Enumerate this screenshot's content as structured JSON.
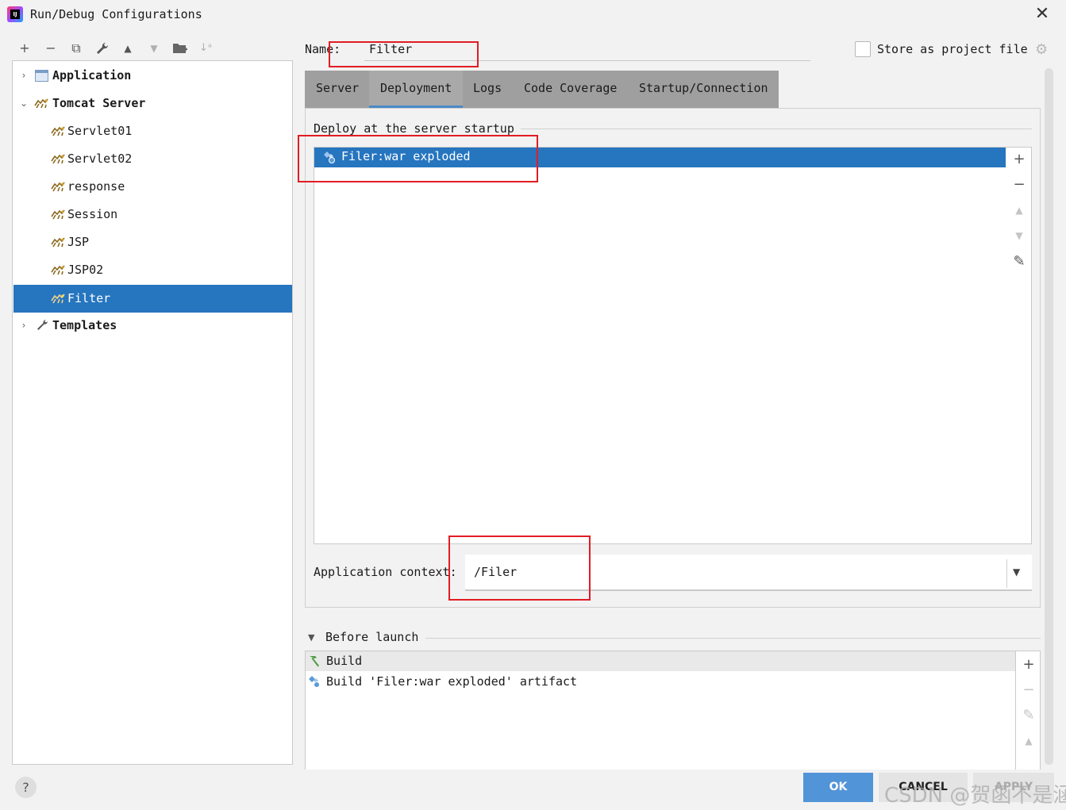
{
  "window": {
    "title": "Run/Debug Configurations",
    "close_glyph": "✕"
  },
  "toolbar": {
    "buttons": [
      {
        "name": "add-icon",
        "glyph": "+"
      },
      {
        "name": "remove-icon",
        "glyph": "−"
      },
      {
        "name": "copy-icon",
        "glyph": "⧉"
      },
      {
        "name": "wrench-icon",
        "glyph": "🔧"
      },
      {
        "name": "move-up-icon",
        "glyph": "▲"
      },
      {
        "name": "move-down-icon",
        "glyph": "▼"
      },
      {
        "name": "folder-add-icon",
        "glyph": "📁"
      },
      {
        "name": "sort-icon",
        "glyph": "↓ᵃ"
      }
    ]
  },
  "tree": {
    "application_label": "Application",
    "tomcat_label": "Tomcat Server",
    "children": [
      "Servlet01",
      "Servlet02",
      "response",
      "Session",
      "JSP",
      "JSP02",
      "Filter"
    ],
    "selected": "Filter",
    "templates_label": "Templates"
  },
  "config": {
    "name_label": "Name:",
    "name_value": "Filter",
    "store_label": "Store as project file",
    "store_checked": false
  },
  "tabs": [
    "Server",
    "Deployment",
    "Logs",
    "Code Coverage",
    "Startup/Connection"
  ],
  "active_tab": "Deployment",
  "deployment": {
    "section_title": "Deploy at the server startup",
    "items": [
      "Filer:war exploded"
    ],
    "side_buttons": [
      "+",
      "−",
      "▲",
      "▼",
      "✎"
    ],
    "app_context_label": "Application context:",
    "app_context_value": "/Filer"
  },
  "before_launch": {
    "title": "Before launch",
    "items": [
      "Build",
      "Build 'Filer:war exploded' artifact"
    ],
    "side_buttons": [
      "+",
      "−",
      "✎",
      "▲"
    ]
  },
  "footer": {
    "help": "?",
    "ok": "OK",
    "cancel": "CANCEL",
    "apply": "APPLY",
    "watermark": "CSDN @贺函不是涵"
  },
  "colors": {
    "selection": "#2675bf",
    "ok_button": "#5294d8",
    "annotation_red": "#e21c24",
    "tab_bar": "#9f9f9f"
  }
}
